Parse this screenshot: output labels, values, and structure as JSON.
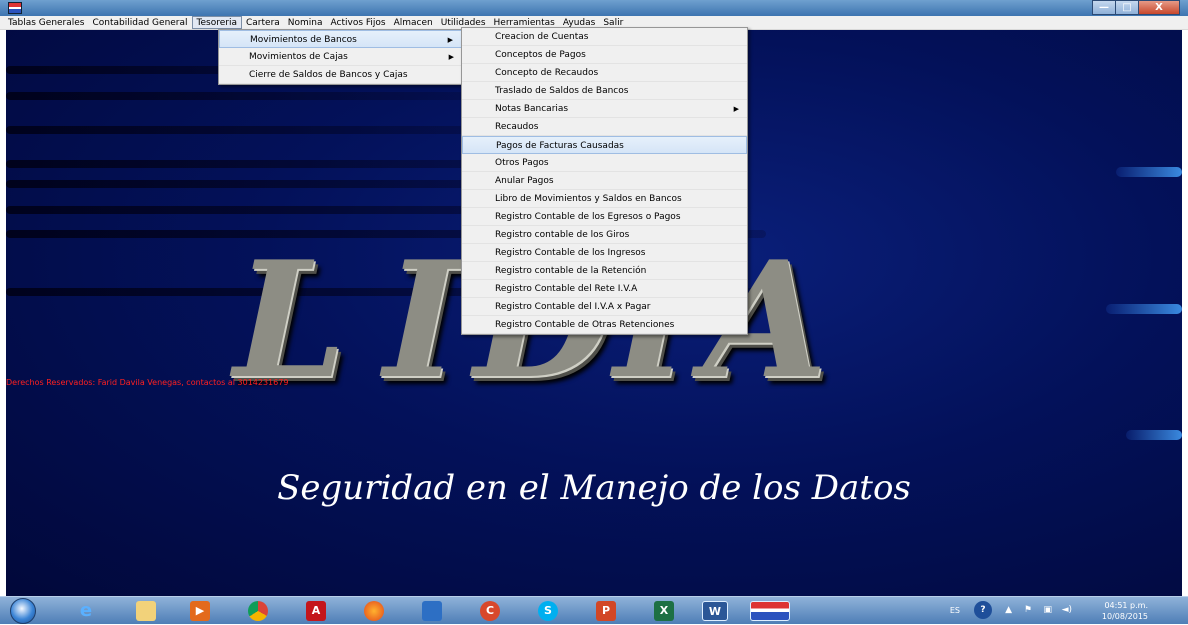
{
  "menubar": {
    "items": [
      "Tablas Generales",
      "Contabilidad General",
      "Tesoreria",
      "Cartera",
      "Nomina",
      "Activos Fijos",
      "Almacen",
      "Utilidades",
      "Herramientas",
      "Ayudas",
      "Salir"
    ],
    "active": "Tesoreria"
  },
  "window_controls": {
    "minimize": "—",
    "maximize": "□",
    "close": "X"
  },
  "tesoreria_menu": [
    {
      "label": "Movimientos de Bancos",
      "submenu": true,
      "highlighted": true
    },
    {
      "label": "Movimientos de Cajas",
      "submenu": true
    },
    {
      "label": "Cierre de Saldos de Bancos y Cajas",
      "submenu": false
    }
  ],
  "bancos_submenu": [
    {
      "label": "Creacion de Cuentas"
    },
    {
      "label": "Conceptos de Pagos"
    },
    {
      "label": "Concepto de Recaudos"
    },
    {
      "label": "Traslado de Saldos de Bancos"
    },
    {
      "label": "Notas Bancarias",
      "submenu": true
    },
    {
      "label": "Recaudos"
    },
    {
      "label": "Pagos de Facturas Causadas",
      "highlighted": true
    },
    {
      "label": "Otros Pagos"
    },
    {
      "label": "Anular Pagos"
    },
    {
      "label": "Libro de Movimientos y Saldos en Bancos"
    },
    {
      "label": "Registro Contable de los Egresos o Pagos"
    },
    {
      "label": "Registro contable de los Giros"
    },
    {
      "label": "Registro Contable de los Ingresos"
    },
    {
      "label": "Registro contable de la Retención"
    },
    {
      "label": "Registro Contable del Rete I.V.A"
    },
    {
      "label": "Registro Contable del I.V.A x Pagar"
    },
    {
      "label": "Registro Contable de Otras Retenciones"
    }
  ],
  "background": {
    "logo_letters": [
      "L",
      "I",
      "D",
      "I",
      "A"
    ],
    "copyright": "Derechos Reservados: Farid Davila Venegas, contactos al 3014231679",
    "tagline": "Seguridad en el Manejo de los Datos"
  },
  "taskbar": {
    "icons": [
      "internet-explorer-icon",
      "file-explorer-icon",
      "media-player-icon",
      "chrome-icon",
      "acrobat-icon",
      "firefox-icon",
      "remote-desktop-icon",
      "ccleaner-icon",
      "skype-icon",
      "powerpoint-icon",
      "excel-icon",
      "word-icon",
      "lidia-app-icon"
    ],
    "language": "ES",
    "time": "04:51 p.m.",
    "date": "10/08/2015"
  },
  "colors": {
    "menu_bg": "#f0f0f0",
    "desktop_bg": "#03115a",
    "copyright": "#ff2020",
    "highlight": "#d5e5f7"
  }
}
